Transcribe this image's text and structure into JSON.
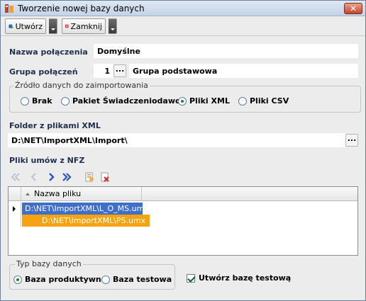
{
  "window": {
    "title": "Tworzenie nowej bazy danych",
    "close_label": "✕"
  },
  "toolbar": {
    "create_label": "Utwórz",
    "close_label": "Zamknij"
  },
  "connection": {
    "name_label": "Nazwa połączenia",
    "name_value": "Domyślne",
    "group_label": "Grupa połączeń",
    "group_number": "1",
    "group_name": "Grupa podstawowa",
    "ellipsis": "..."
  },
  "import_source": {
    "legend": "Źródło danych do zaimportowania",
    "options": [
      "Brak",
      "Pakiet Świadczeniodawcy",
      "Pliki XML",
      "Pliki CSV"
    ],
    "selected": "Pliki XML"
  },
  "folder": {
    "label": "Folder z plikami XML",
    "value": "D:\\NET\\ImportXML\\Import\\",
    "ellipsis": "..."
  },
  "contracts": {
    "label": "Pliki umów z NFZ",
    "column_header": "Nazwa pliku",
    "rows": [
      "D:\\NET\\ImportXML\\L_O_MS.umx",
      "D:\\NET\\ImportXML\\PS.umx"
    ]
  },
  "db_type": {
    "legend": "Typ bazy danych",
    "options": [
      "Baza produktywna",
      "Baza testowa"
    ],
    "selected": "Baza produktywna"
  },
  "create_test_db": {
    "label": "Utwórz bazę testową",
    "checked": true
  },
  "icons": {
    "app": "database-icon",
    "create": "database-create-icon",
    "close": "close-red-icon",
    "nav": [
      "first-icon",
      "prev-icon",
      "next-icon",
      "last-icon",
      "add-file-icon",
      "delete-file-icon"
    ]
  }
}
